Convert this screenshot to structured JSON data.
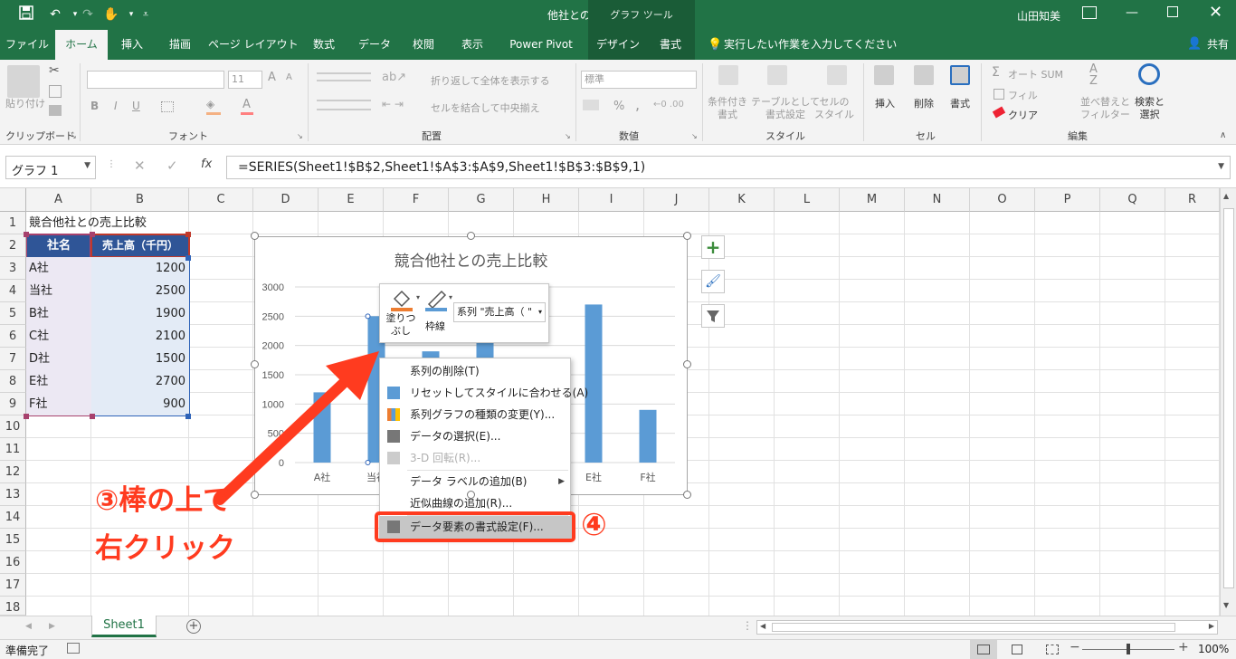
{
  "window": {
    "title": "他社との売上比較　-　Excel",
    "context_tab_group": "グラフ ツール",
    "user": "山田知美"
  },
  "ribbon_tabs": [
    "ファイル",
    "ホーム",
    "挿入",
    "描画",
    "ページ レイアウト",
    "数式",
    "データ",
    "校閲",
    "表示",
    "Power Pivot",
    "デザイン",
    "書式"
  ],
  "tell_me": "実行したい作業を入力してください",
  "share": "共有",
  "ribbon": {
    "clipboard": {
      "paste": "貼り付け",
      "label": "クリップボード"
    },
    "font": {
      "size": "11",
      "bold": "B",
      "italic": "I",
      "underline": "U",
      "label": "フォント",
      "grow": "A",
      "shrink": "A"
    },
    "alignment": {
      "wrap": "折り返して全体を表示する",
      "merge": "セルを結合して中央揃え",
      "label": "配置"
    },
    "number": {
      "format": "標準",
      "label": "数値",
      "percent": "%",
      "comma": ","
    },
    "styles": {
      "conditional": "条件付き\n書式",
      "table": "テーブルとして\n書式設定",
      "cell": "セルの\nスタイル",
      "label": "スタイル"
    },
    "cells": {
      "insert": "挿入",
      "delete": "削除",
      "format": "書式",
      "label": "セル"
    },
    "editing": {
      "autosum": "オート SUM",
      "fill": "フィル",
      "clear": "クリア",
      "sort": "並べ替えと\nフィルター",
      "find": "検索と\n選択",
      "label": "編集"
    }
  },
  "formula_bar": {
    "name_box": "グラフ 1",
    "fx": "fx",
    "formula": "=SERIES(Sheet1!$B$2,Sheet1!$A$3:$A$9,Sheet1!$B$3:$B$9,1)"
  },
  "columns": [
    "A",
    "B",
    "C",
    "D",
    "E",
    "F",
    "G",
    "H",
    "I",
    "J",
    "K",
    "L",
    "M",
    "N",
    "O",
    "P",
    "Q",
    "R"
  ],
  "rows": [
    "1",
    "2",
    "3",
    "4",
    "5",
    "6",
    "7",
    "8",
    "9",
    "10",
    "11",
    "12",
    "13",
    "14",
    "15",
    "16",
    "17",
    "18"
  ],
  "sheet": {
    "A1": "競合他社との売上比較",
    "header": [
      "社名",
      "売上高（千円）"
    ],
    "table": [
      {
        "name": "A社",
        "value": "1200"
      },
      {
        "name": "当社",
        "value": "2500"
      },
      {
        "name": "B社",
        "value": "1900"
      },
      {
        "name": "C社",
        "value": "2100"
      },
      {
        "name": "D社",
        "value": "1500"
      },
      {
        "name": "E社",
        "value": "2700"
      },
      {
        "name": "F社",
        "value": "900"
      }
    ]
  },
  "chart_data": {
    "type": "bar",
    "title": "競合他社との売上比較",
    "categories": [
      "A社",
      "当社",
      "B社",
      "C社",
      "D社",
      "E社",
      "F社"
    ],
    "series": [
      {
        "values": [
          1200,
          2500,
          1900,
          2100,
          1500,
          2700,
          900
        ]
      }
    ],
    "yticks": [
      "0",
      "500",
      "1000",
      "1500",
      "2000",
      "2500",
      "3000"
    ],
    "ylim": [
      0,
      3000
    ],
    "bar_color": "#5b9bd5",
    "grid": true
  },
  "mini_toolbar": {
    "fill": "塗りつ\nぶし",
    "outline": "枠線",
    "series_dropdown": "系列 \"売上高（ \""
  },
  "context_menu": [
    {
      "label": "系列の削除(T)",
      "icon": "delete-icon",
      "enabled": true
    },
    {
      "label": "リセットしてスタイルに合わせる(A)",
      "icon": "reset-style-icon",
      "enabled": true
    },
    {
      "label": "系列グラフの種類の変更(Y)...",
      "icon": "chart-type-icon",
      "enabled": true
    },
    {
      "label": "データの選択(E)...",
      "icon": "select-data-icon",
      "enabled": true
    },
    {
      "label": "3-D 回転(R)...",
      "icon": "rotate-3d-icon",
      "enabled": false
    },
    {
      "label": "データ ラベルの追加(B)",
      "icon": "",
      "enabled": true,
      "submenu": true
    },
    {
      "label": "近似曲線の追加(R)...",
      "icon": "",
      "enabled": true
    },
    {
      "label": "データ要素の書式設定(F)...",
      "icon": "format-icon",
      "enabled": true,
      "highlighted": true
    }
  ],
  "annotations": {
    "step3_line1": "③棒の上で",
    "step3_line2": "右クリック",
    "step4": "④",
    "color": "#ff3b1f"
  },
  "sheet_tab": "Sheet1",
  "status": {
    "ready": "準備完了",
    "zoom": "100%"
  }
}
